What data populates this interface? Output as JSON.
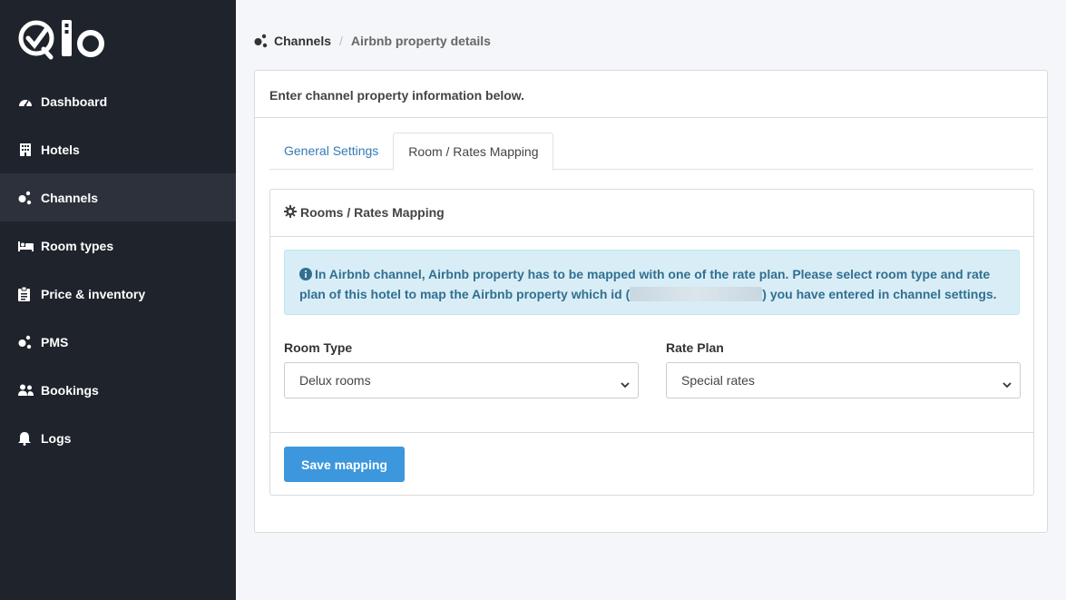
{
  "sidebar": {
    "logo_text": "Qio",
    "items": [
      {
        "label": "Dashboard",
        "icon": "dashboard-icon"
      },
      {
        "label": "Hotels",
        "icon": "building-icon"
      },
      {
        "label": "Channels",
        "icon": "channels-icon",
        "active": true
      },
      {
        "label": "Room types",
        "icon": "bed-icon"
      },
      {
        "label": "Price & inventory",
        "icon": "clipboard-icon"
      },
      {
        "label": "PMS",
        "icon": "pms-icon"
      },
      {
        "label": "Bookings",
        "icon": "users-icon"
      },
      {
        "label": "Logs",
        "icon": "bell-icon"
      }
    ]
  },
  "breadcrumb": {
    "parent": "Channels",
    "current": "Airbnb property details"
  },
  "card": {
    "header": "Enter channel property information below."
  },
  "tabs": [
    {
      "label": "General Settings",
      "active": false
    },
    {
      "label": "Room / Rates Mapping",
      "active": true
    }
  ],
  "mapping": {
    "title": "Rooms / Rates Mapping",
    "alert_before": "In Airbnb channel, Airbnb property has to be mapped with one of the rate plan. Please select room type and rate plan of this hotel to map the Airbnb property which id (",
    "alert_after": ") you have entered in channel settings.",
    "room_type_label": "Room Type",
    "room_type_value": "Delux rooms",
    "rate_plan_label": "Rate Plan",
    "rate_plan_value": "Special rates",
    "save_label": "Save mapping"
  },
  "colors": {
    "sidebar_bg": "#1f232b",
    "accent": "#3c97dd",
    "link": "#337ab7",
    "alert_bg": "#d9edf7",
    "alert_text": "#31708f"
  }
}
